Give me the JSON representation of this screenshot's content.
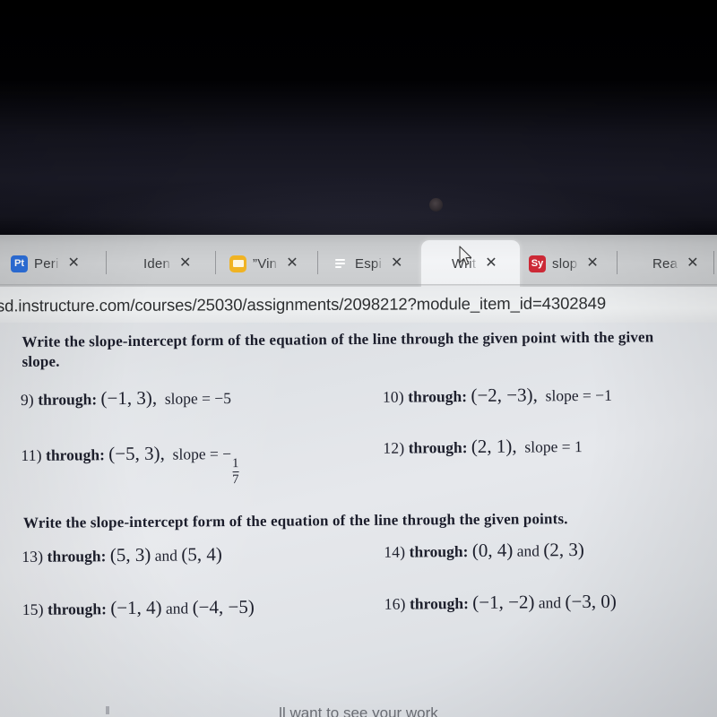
{
  "browser": {
    "tabs": [
      {
        "title": "Peri",
        "icon": "prezi-pt-icon",
        "icon_label": "Pt",
        "icon_color": "#2c6fdb",
        "active": false,
        "close_label": "✕"
      },
      {
        "title": "Iden",
        "icon": "canvas-lms-icon",
        "icon_label": "",
        "icon_color": "#d14b3d",
        "active": false,
        "close_label": "✕"
      },
      {
        "title": "”Vin",
        "icon": "notes-icon",
        "icon_label": "",
        "icon_color": "#f0b323",
        "active": false,
        "close_label": "✕"
      },
      {
        "title": "Espi",
        "icon": "google-docs-icon",
        "icon_label": "",
        "icon_color": "#2b7de9",
        "active": false,
        "close_label": "✕"
      },
      {
        "title": "Writ",
        "icon": "canvas-lms-icon",
        "icon_label": "",
        "icon_color": "#d14b3d",
        "active": true,
        "close_label": "✕"
      },
      {
        "title": "slop",
        "icon": "symbolab-sy-icon",
        "icon_label": "Sy",
        "icon_color": "#cc2936",
        "active": false,
        "close_label": "✕"
      },
      {
        "title": "Rea",
        "icon": "canvas-lms-icon",
        "icon_label": "",
        "icon_color": "#d14b3d",
        "active": false,
        "close_label": "✕"
      }
    ],
    "url": "sd.instructure.com/courses/25030/assignments/2098212?module_item_id=4302849"
  },
  "worksheet": {
    "heading1": "Write the slope-intercept form of the equation of the line through the given point with the given slope.",
    "heading2": "Write the slope-intercept form of the equation of the line through the given points.",
    "problems_point_slope": [
      {
        "num": "9)",
        "label": "through:",
        "point": "(−1, 3),",
        "slope_label": "slope =",
        "slope": "−5"
      },
      {
        "num": "10)",
        "label": "through:",
        "point": "(−2, −3),",
        "slope_label": "slope =",
        "slope": "−1"
      },
      {
        "num": "11)",
        "label": "through:",
        "point": "(−5, 3),",
        "slope_label": "slope =",
        "slope": "−",
        "slope_frac_num": "1",
        "slope_frac_den": "7"
      },
      {
        "num": "12)",
        "label": "through:",
        "point": "(2, 1),",
        "slope_label": "slope =",
        "slope": "1"
      }
    ],
    "problems_two_points": [
      {
        "num": "13)",
        "label": "through:",
        "point1": "(5, 3)",
        "conj": "and",
        "point2": "(5, 4)"
      },
      {
        "num": "14)",
        "label": "through:",
        "point1": "(0, 4)",
        "conj": "and",
        "point2": "(2, 3)"
      },
      {
        "num": "15)",
        "label": "through:",
        "point1": "(−1, 4)",
        "conj": "and",
        "point2": "(−4, −5)"
      },
      {
        "num": "16)",
        "label": "through:",
        "point1": "(−1, −2)",
        "conj": "and",
        "point2": "(−3, 0)"
      }
    ],
    "footer_partial": "ll want to see your work"
  }
}
